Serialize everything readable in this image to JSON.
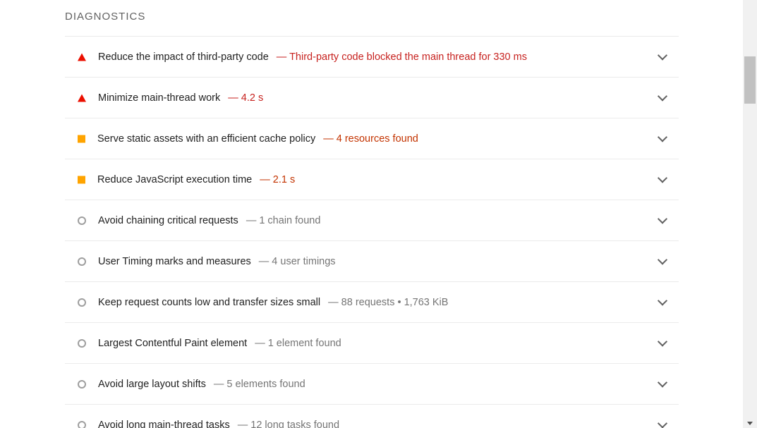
{
  "section": {
    "title": "DIAGNOSTICS"
  },
  "audits": [
    {
      "title": "Reduce the impact of third-party code",
      "value": "Third-party code blocked the main thread for 330 ms",
      "status": "fail"
    },
    {
      "title": "Minimize main-thread work",
      "value": "4.2 s",
      "status": "fail"
    },
    {
      "title": "Serve static assets with an efficient cache policy",
      "value": "4 resources found",
      "status": "average"
    },
    {
      "title": "Reduce JavaScript execution time",
      "value": "2.1 s",
      "status": "average"
    },
    {
      "title": "Avoid chaining critical requests",
      "value": "1 chain found",
      "status": "info"
    },
    {
      "title": "User Timing marks and measures",
      "value": "4 user timings",
      "status": "info"
    },
    {
      "title": "Keep request counts low and transfer sizes small",
      "value": "88 requests • 1,763 KiB",
      "status": "info"
    },
    {
      "title": "Largest Contentful Paint element",
      "value": "1 element found",
      "status": "info"
    },
    {
      "title": "Avoid large layout shifts",
      "value": "5 elements found",
      "status": "info"
    },
    {
      "title": "Avoid long main-thread tasks",
      "value": "12 long tasks found",
      "status": "info"
    }
  ],
  "separator": "—",
  "colors": {
    "fail": "#eb0f00",
    "average": "#ffa400",
    "info": "#9e9e9e"
  }
}
